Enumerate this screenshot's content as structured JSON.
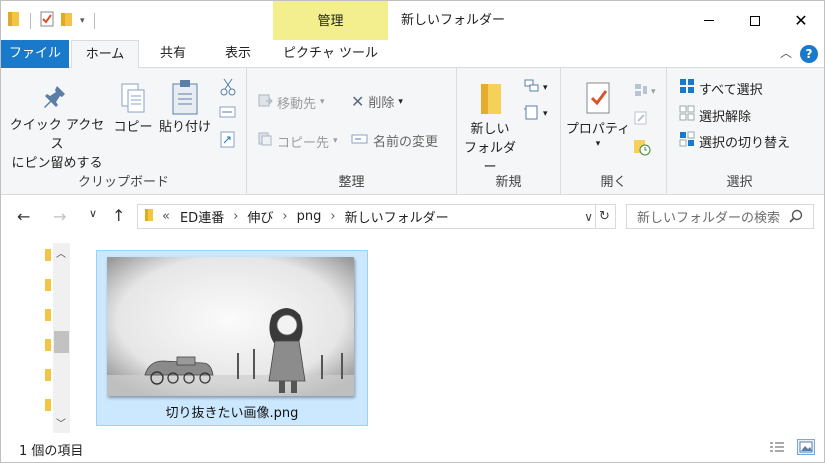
{
  "window": {
    "title": "新しいフォルダー",
    "context_tab_group": "管理"
  },
  "tabs": {
    "file": "ファイル",
    "home": "ホーム",
    "share": "共有",
    "view": "表示",
    "picture_tools": "ピクチャ ツール",
    "help": "?"
  },
  "ribbon": {
    "clipboard": {
      "label": "クリップボード",
      "pin_line1": "クイック アクセス",
      "pin_line2": "にピン留めする",
      "copy": "コピー",
      "paste": "貼り付け"
    },
    "organize": {
      "label": "整理",
      "move_to": "移動先",
      "copy_to": "コピー先",
      "delete": "削除",
      "rename": "名前の変更"
    },
    "new": {
      "label": "新規",
      "new_folder_line1": "新しい",
      "new_folder_line2": "フォルダー"
    },
    "open": {
      "label": "開く",
      "properties": "プロパティ"
    },
    "select": {
      "label": "選択",
      "select_all": "すべて選択",
      "select_none": "選択解除",
      "invert": "選択の切り替え"
    }
  },
  "address": {
    "overflow": "«",
    "crumbs": [
      "ED連番",
      "伸び",
      "png",
      "新しいフォルダー"
    ],
    "search_placeholder": "新しいフォルダーの検索"
  },
  "files": [
    {
      "name": "切り抜きたい画像.png",
      "selected": true
    }
  ],
  "status": {
    "count_text": "1 個の項目"
  },
  "colors": {
    "accent": "#1979ca",
    "context_tab": "#f3ee8e",
    "selection": "#cce8ff",
    "selection_border": "#99d1ff"
  }
}
